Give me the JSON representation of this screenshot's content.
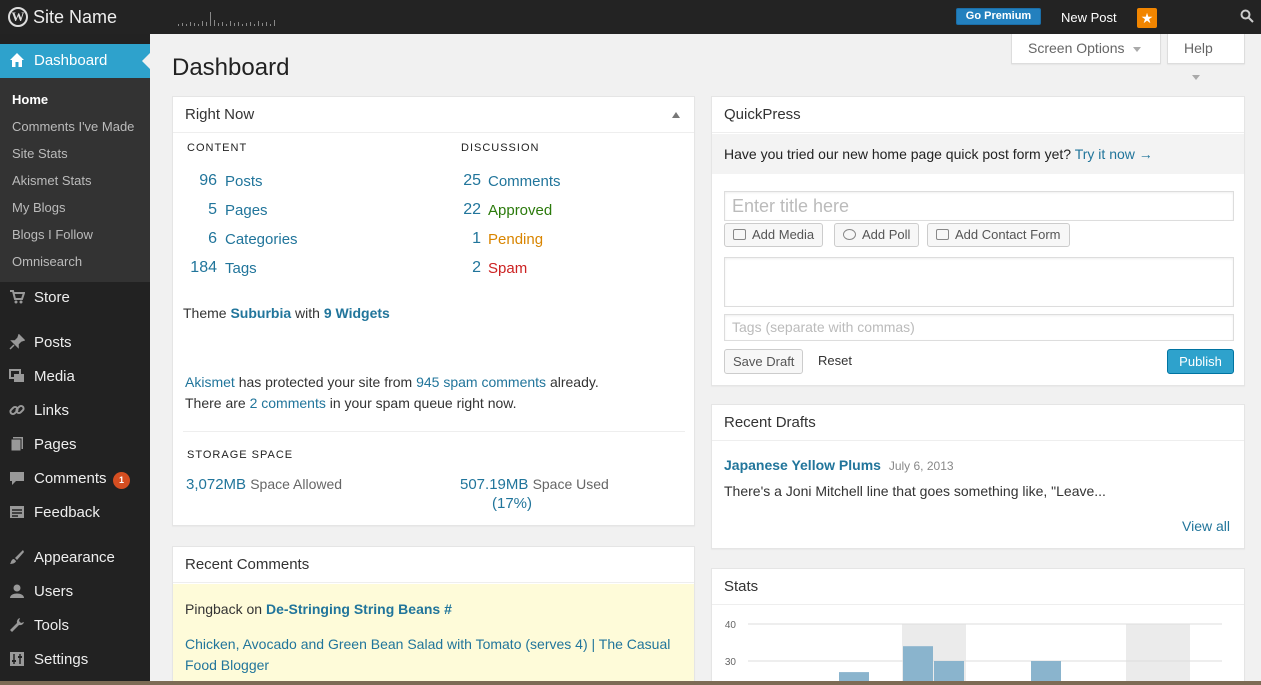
{
  "adminbar": {
    "site_name": "Site Name",
    "go_premium": "Go Premium",
    "new_post": "New Post",
    "notification_glyph": "★"
  },
  "sidebar": {
    "dashboard": "Dashboard",
    "submenu": [
      "Home",
      "Comments I've Made",
      "Site Stats",
      "Akismet Stats",
      "My Blogs",
      "Blogs I Follow",
      "Omnisearch"
    ],
    "items": [
      "Store",
      "Posts",
      "Media",
      "Links",
      "Pages",
      "Comments",
      "Feedback",
      "Appearance",
      "Users",
      "Tools",
      "Settings"
    ],
    "comments_badge": "1"
  },
  "header": {
    "title": "Dashboard",
    "screen_options": "Screen Options",
    "help": "Help"
  },
  "right_now": {
    "title": "Right Now",
    "content_heading": "CONTENT",
    "discussion_heading": "DISCUSSION",
    "content": [
      {
        "num": "96",
        "label": "Posts"
      },
      {
        "num": "5",
        "label": "Pages"
      },
      {
        "num": "6",
        "label": "Categories"
      },
      {
        "num": "184",
        "label": "Tags"
      }
    ],
    "discussion": [
      {
        "num": "25",
        "label": "Comments"
      },
      {
        "num": "22",
        "label": "Approved"
      },
      {
        "num": "1",
        "label": "Pending"
      },
      {
        "num": "2",
        "label": "Spam"
      }
    ],
    "theme_prefix": "Theme",
    "theme_name": "Suburbia",
    "theme_with": "with",
    "widgets": "9 Widgets",
    "akismet": "Akismet",
    "akismet_text1": "has protected your site from",
    "akismet_spam": "945 spam comments",
    "akismet_text2": "already.",
    "akismet_text3": "There are",
    "akismet_queue": "2 comments",
    "akismet_text4": "in your spam queue right now.",
    "storage_heading": "STORAGE SPACE",
    "space_allowed_value": "3,072MB",
    "space_allowed_label": "Space Allowed",
    "space_used_value": "507.19MB",
    "space_used_label": "Space Used",
    "space_used_percent": "(17%)"
  },
  "recent_comments": {
    "title": "Recent Comments",
    "pingback": "Pingback",
    "on": "on",
    "post_link": "De-Stringing String Beans #",
    "excerpt": "Chicken, Avocado and Green Bean Salad with Tomato (serves 4) | The Casual Food Blogger"
  },
  "quickpress": {
    "title": "QuickPress",
    "notice": "Have you tried our new home page quick post form yet?",
    "notice_link": "Try it now →",
    "title_placeholder": "Enter title here",
    "add_media": "Add Media",
    "add_poll": "Add Poll",
    "add_contact_form": "Add Contact Form",
    "tags_placeholder": "Tags (separate with commas)",
    "save_draft": "Save Draft",
    "reset": "Reset",
    "publish": "Publish"
  },
  "recent_drafts": {
    "title": "Recent Drafts",
    "draft_title": "Japanese Yellow Plums",
    "draft_date": "July 6, 2013",
    "draft_excerpt": "There's a Joni Mitchell line that goes something like, \"Leave...",
    "view_all": "View all"
  },
  "stats": {
    "title": "Stats",
    "chart_data": {
      "type": "bar",
      "ylim": [
        20,
        40
      ],
      "yticks": [
        "40",
        "30"
      ],
      "categories": [],
      "values": [
        27,
        34,
        30,
        30
      ]
    }
  },
  "colors": {
    "accent": "#2ea2cc",
    "link": "#21759b",
    "badge": "#d54e21",
    "approved": "#2b7a0b",
    "pending": "#d98500",
    "spam": "#cc2222"
  }
}
